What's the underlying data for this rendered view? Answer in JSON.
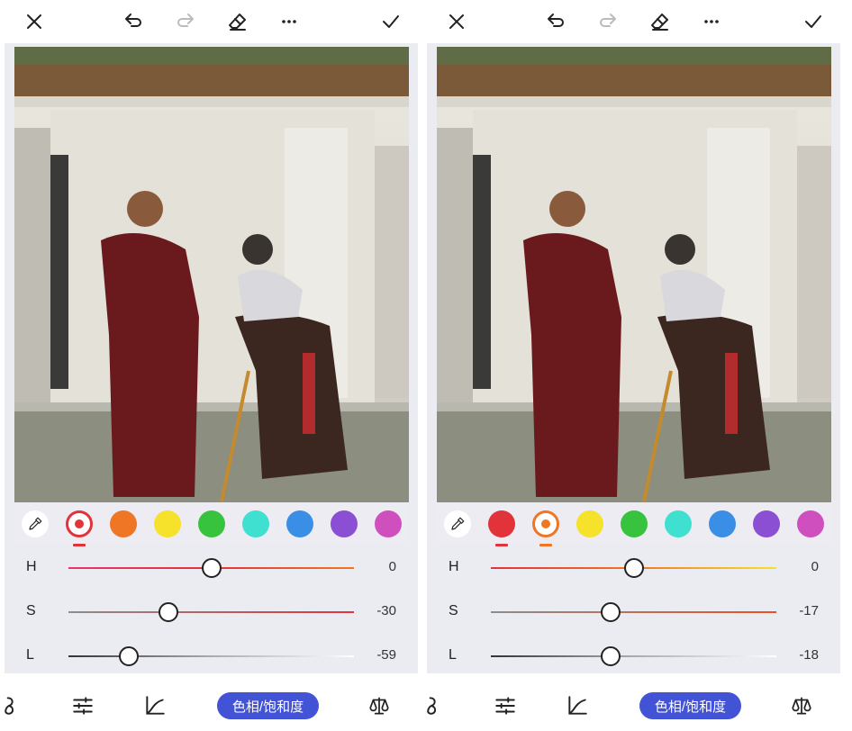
{
  "panels": [
    {
      "id": "left",
      "toolbar": {
        "close_icon": "close-icon",
        "undo_icon": "undo-icon",
        "redo_icon": "redo-icon",
        "eraser_icon": "eraser-icon",
        "more_icon": "more-icon",
        "confirm_icon": "check-icon",
        "redo_enabled": true
      },
      "photo_watermark": "",
      "color_swatches": [
        {
          "name": "red",
          "color": "#e2333a",
          "selected": true
        },
        {
          "name": "orange",
          "color": "#ee7625",
          "selected": false
        },
        {
          "name": "yellow",
          "color": "#f6e12b",
          "selected": false
        },
        {
          "name": "green",
          "color": "#37c33d",
          "selected": false
        },
        {
          "name": "cyan",
          "color": "#3fe0d0",
          "selected": false
        },
        {
          "name": "blue",
          "color": "#3b8ee6",
          "selected": false
        },
        {
          "name": "purple",
          "color": "#8b4fd3",
          "selected": false
        },
        {
          "name": "magenta",
          "color": "#cf4fbe",
          "selected": false
        }
      ],
      "underline_under": [
        "red"
      ],
      "sliders": [
        {
          "label": "H",
          "value": "0",
          "position": 0.5,
          "gradient": [
            "#e8336e",
            "#e2333a",
            "#ee7625"
          ]
        },
        {
          "label": "S",
          "value": "-30",
          "position": 0.35,
          "gradient": [
            "#8c8c8c",
            "#e2333a"
          ]
        },
        {
          "label": "L",
          "value": "-59",
          "position": 0.21,
          "gradient": [
            "#333333",
            "#aaaaaa",
            "#ffffff"
          ]
        }
      ]
    },
    {
      "id": "right",
      "toolbar": {
        "close_icon": "close-icon",
        "undo_icon": "undo-icon",
        "redo_icon": "redo-icon",
        "eraser_icon": "eraser-icon",
        "more_icon": "more-icon",
        "confirm_icon": "check-icon",
        "redo_enabled": false
      },
      "photo_watermark": "",
      "color_swatches": [
        {
          "name": "red",
          "color": "#e2333a",
          "selected": false
        },
        {
          "name": "orange",
          "color": "#ee7625",
          "selected": true
        },
        {
          "name": "yellow",
          "color": "#f6e12b",
          "selected": false
        },
        {
          "name": "green",
          "color": "#37c33d",
          "selected": false
        },
        {
          "name": "cyan",
          "color": "#3fe0d0",
          "selected": false
        },
        {
          "name": "blue",
          "color": "#3b8ee6",
          "selected": false
        },
        {
          "name": "purple",
          "color": "#8b4fd3",
          "selected": false
        },
        {
          "name": "magenta",
          "color": "#cf4fbe",
          "selected": false
        }
      ],
      "underline_under": [
        "red",
        "orange"
      ],
      "sliders": [
        {
          "label": "H",
          "value": "0",
          "position": 0.5,
          "gradient": [
            "#e2333a",
            "#ee7625",
            "#f6e12b"
          ]
        },
        {
          "label": "S",
          "value": "-17",
          "position": 0.42,
          "gradient": [
            "#8c8c8c",
            "#ee5020"
          ]
        },
        {
          "label": "L",
          "value": "-18",
          "position": 0.42,
          "gradient": [
            "#333333",
            "#aaaaaa",
            "#ffffff"
          ]
        }
      ]
    }
  ],
  "bottom_bar": {
    "icons": [
      "beauty-icon",
      "adjust-icon",
      "curve-icon",
      "balance-icon"
    ],
    "active_tab_label": "色相/饱和度",
    "accent_color": "#4253d6"
  }
}
